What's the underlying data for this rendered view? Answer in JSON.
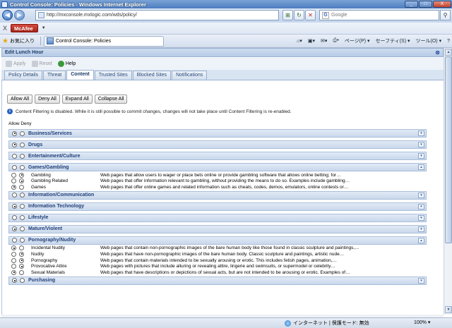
{
  "window": {
    "title": "Control Console: Policies - Windows Internet Explorer",
    "min": "_",
    "max": "□",
    "close": "X"
  },
  "browser": {
    "back": "◀",
    "forward": "▶",
    "address": "http://mxconsole.mxlogic.com/wds/policy/",
    "search_placeholder": "Google",
    "search_logo": "G",
    "go": "⚲",
    "mcafee": "McAfee",
    "mcafee_prefix": "X",
    "favorites": "お気に入り",
    "tab_title": "Control Console: Policies",
    "commands": {
      "page": "ページ(P) ▾",
      "safety": "セーフティ(S) ▾",
      "tools": "ツール(O) ▾",
      "help": "?"
    }
  },
  "panel": {
    "title": "Edit Lunch Hour",
    "close": "⊗",
    "actions": {
      "apply": "Apply",
      "reset": "Reset",
      "help": "Help"
    },
    "tabs": [
      "Policy Details",
      "Threat",
      "Content",
      "Trusted Sites",
      "Blocked Sites",
      "Notifications"
    ],
    "active_tab": "Content"
  },
  "content": {
    "buttons": {
      "allow_all": "Allow All",
      "deny_all": "Deny All",
      "expand_all": "Expand All",
      "collapse_all": "Collapse All"
    },
    "notice": "Content Filtering is disabled. While it is still possible to commit changes, changes will not take place until Content Filtering is re-enabled.",
    "notice_icon": "i",
    "col_allow": "Allow",
    "col_deny": "Deny",
    "categories": [
      {
        "label": "Business/Services",
        "allow": true,
        "expanded": false
      },
      {
        "label": "Drugs",
        "allow": true,
        "expanded": false
      },
      {
        "label": "Entertainment/Culture",
        "allow": null,
        "expanded": false
      },
      {
        "label": "Games/Gambling",
        "allow": null,
        "expanded": true,
        "items": [
          {
            "name": "Gambling",
            "allow": false,
            "desc": "Web pages that allow users to wager or place bets online or provide gambling software that allows online betting; for…"
          },
          {
            "name": "Gambling Related",
            "allow": false,
            "desc": "Web pages that offer information relevant to gambling, without providing the means to do so. Examples include gambling…"
          },
          {
            "name": "Games",
            "allow": true,
            "desc": "Web pages that offer online games and related information such as cheats, codes, demos, emulators, online contests or…"
          }
        ]
      },
      {
        "label": "Information/Communication",
        "allow": null,
        "expanded": false
      },
      {
        "label": "Information Technology",
        "allow": true,
        "expanded": false
      },
      {
        "label": "Lifestyle",
        "allow": null,
        "expanded": false
      },
      {
        "label": "Mature/Violent",
        "allow": true,
        "expanded": false
      },
      {
        "label": "Pornography/Nudity",
        "allow": null,
        "expanded": true,
        "items": [
          {
            "name": "Incidental Nudity",
            "allow": true,
            "desc": "Web pages that contain non-pornographic images of the bare human body like those found in classic sculpture and paintings,…"
          },
          {
            "name": "Nudity",
            "allow": false,
            "desc": "Web pages that have non-pornographic images of the bare human body. Classic sculpture and paintings, artistic nude…"
          },
          {
            "name": "Pornography",
            "allow": false,
            "desc": "Web pages that contain materials intended to be sexually arousing or erotic. This includes fetish pages, animation,…"
          },
          {
            "name": "Provocative Attire",
            "allow": false,
            "desc": "Web pages with pictures that include alluring or revealing attire, lingerie and swimsuits, or supermodel or celebrity…"
          },
          {
            "name": "Sexual Materials",
            "allow": true,
            "desc": "Web pages that have descriptions or depictions of sexual acts, but are not intended to be arousing or erotic. Examples of…"
          }
        ]
      },
      {
        "label": "Purchasing",
        "allow": true,
        "expanded": false
      }
    ],
    "expand_glyph": "▾",
    "collapse_glyph": "▴"
  },
  "status": {
    "zone": "インターネット | 保護モード: 無効",
    "zoom": "100% ▾"
  }
}
